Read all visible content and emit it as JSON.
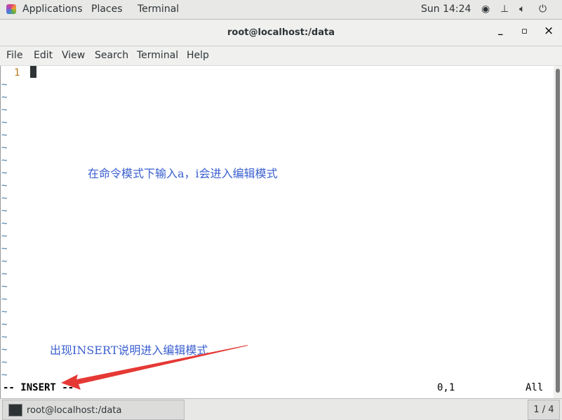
{
  "topbar": {
    "applications": "Applications",
    "places": "Places",
    "terminal": "Terminal",
    "clock": "Sun 14:24",
    "icons": [
      "accessibility-icon",
      "network-icon",
      "volume-icon",
      "power-icon"
    ]
  },
  "window": {
    "title": "root@localhost:/data",
    "minimize": "_",
    "maximize": "▫",
    "close": "×"
  },
  "menu": [
    "File",
    "Edit",
    "View",
    "Search",
    "Terminal",
    "Help"
  ],
  "editor": {
    "line_number": "1",
    "tilde": "~",
    "mode": "-- INSERT --",
    "position": "0,1",
    "scroll": "All"
  },
  "annotations": {
    "top": "在命令模式下输入a，i会进入编辑模式",
    "bottom": "出现INSERT说明进入编辑模式",
    "arrow_color": "#e53935",
    "text_color": "#3a5fd0"
  },
  "taskbar": {
    "item": "root@localhost:/data",
    "workspace": "1 / 4"
  }
}
